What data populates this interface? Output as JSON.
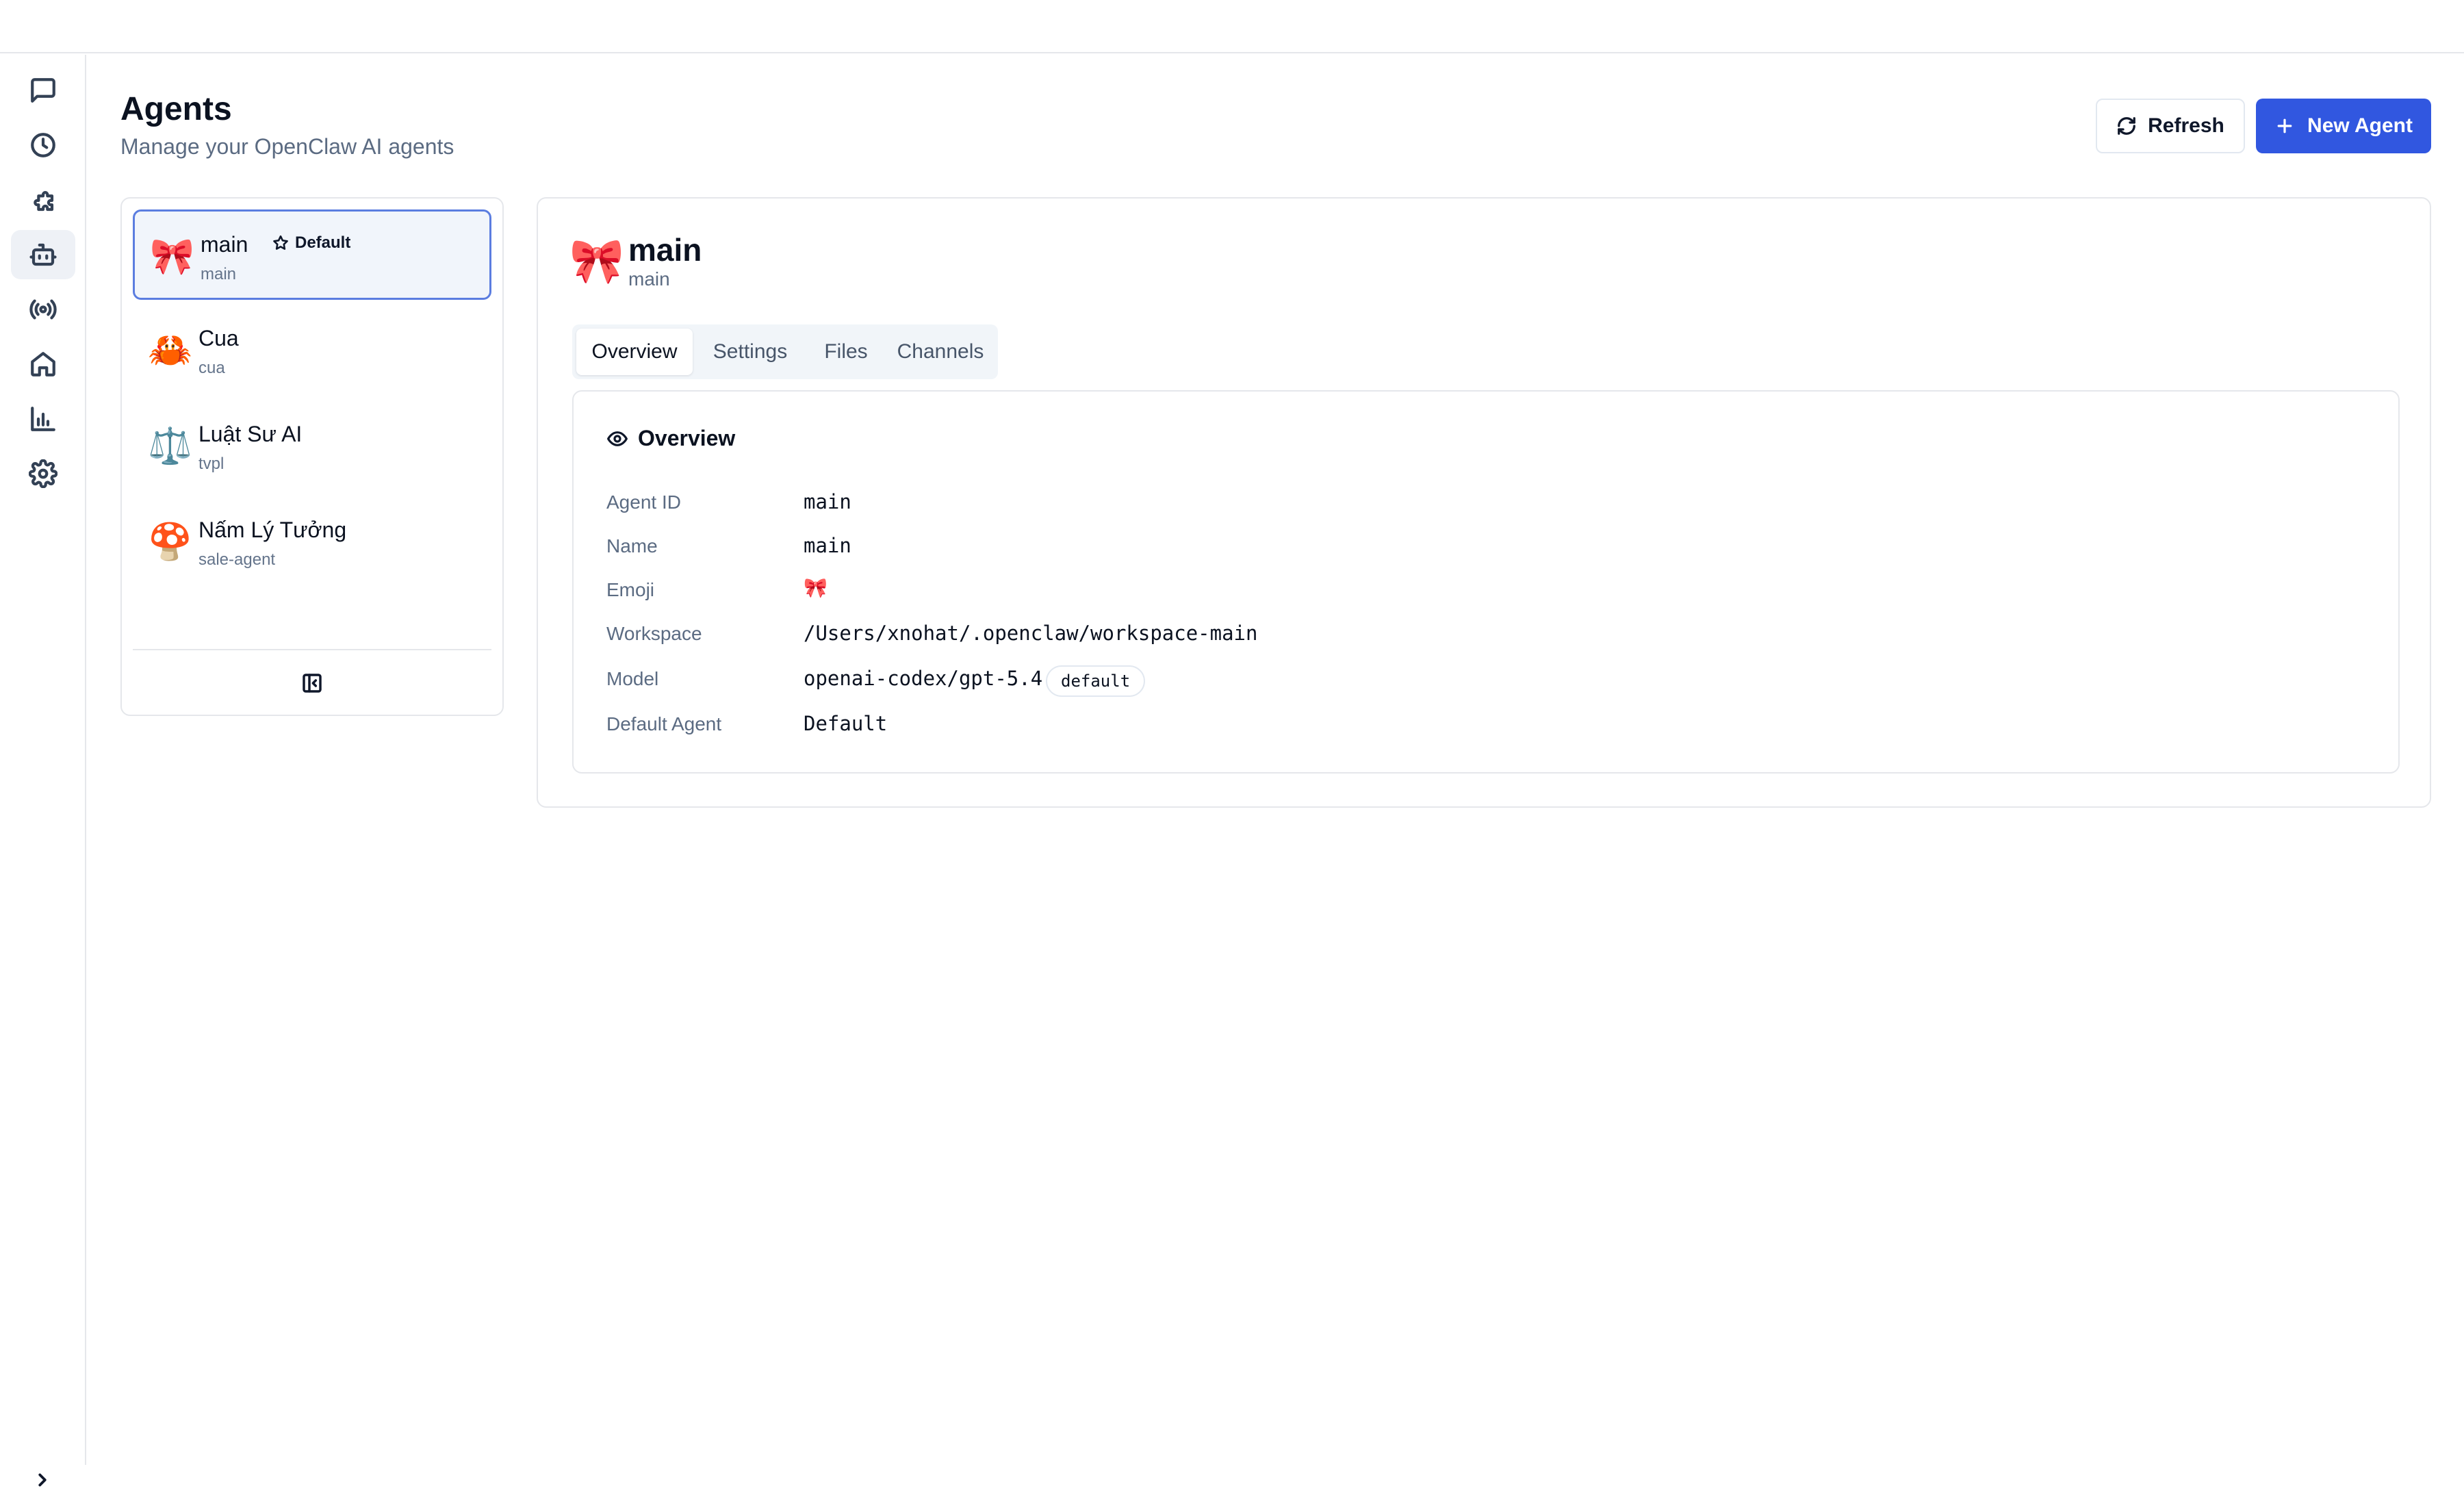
{
  "header": {
    "title": "Agents",
    "subtitle": "Manage your OpenClaw AI agents",
    "refresh_label": "Refresh",
    "new_agent_label": "New Agent"
  },
  "nav": {
    "items": [
      "chat-icon",
      "clock-icon",
      "puzzle-icon",
      "bot-icon",
      "radio-icon",
      "home-icon",
      "bar-chart-icon",
      "settings-icon"
    ],
    "active": "bot-icon",
    "expand_icon": "chevron-right-icon"
  },
  "agents": [
    {
      "emoji": "🎀",
      "name": "main",
      "id": "main",
      "badge": "Default",
      "selected": true
    },
    {
      "emoji": "🦀",
      "name": "Cua",
      "id": "cua"
    },
    {
      "emoji": "⚖️",
      "name": "Luật Sư AI",
      "id": "tvpl"
    },
    {
      "emoji": "🍄",
      "name": "Nấm Lý Tưởng",
      "id": "sale-agent"
    }
  ],
  "detail": {
    "emoji": "🎀",
    "name": "main",
    "id": "main",
    "tabs": [
      "Overview",
      "Settings",
      "Files",
      "Channels"
    ],
    "active_tab": "Overview",
    "overview": {
      "title": "Overview",
      "rows": [
        {
          "label": "Agent ID",
          "value": "main"
        },
        {
          "label": "Name",
          "value": "main"
        },
        {
          "label": "Emoji",
          "value": "🎀"
        },
        {
          "label": "Workspace",
          "value": "/Users/xnohat/.openclaw/workspace-main"
        },
        {
          "label": "Model",
          "value": "openai-codex/gpt-5.4",
          "badge": "default"
        },
        {
          "label": "Default Agent",
          "value": "Default"
        }
      ]
    }
  },
  "colors": {
    "primary": "#3157e0",
    "selected_border": "#5b7de0",
    "muted_text": "#5b6b82",
    "border": "#e5e7eb"
  }
}
